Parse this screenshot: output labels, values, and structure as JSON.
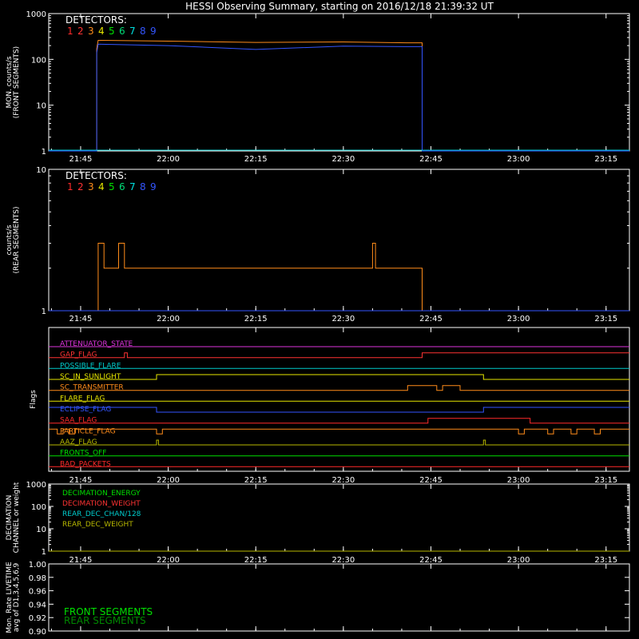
{
  "title": "HESSI Observing Summary, starting on 2016/12/18 21:39:32 UT",
  "time_ticks": [
    "21:45",
    "22:00",
    "22:15",
    "22:30",
    "22:45",
    "23:00",
    "23:15"
  ],
  "colors": {
    "axes": "#ffffff",
    "det": [
      "#ff2a2a",
      "#ff3333",
      "#ff8c1a",
      "#e6e600",
      "#00e000",
      "#00dd77",
      "#00e0e0",
      "#3355ff",
      "#3355ff"
    ]
  },
  "detectors_label": "DETECTORS:",
  "detector_numbers": [
    "1",
    "2",
    "3",
    "4",
    "5",
    "6",
    "7",
    "8",
    "9"
  ],
  "chart_data": [
    {
      "name": "front",
      "type": "line",
      "ylabel": [
        "MON. counts/s",
        "(FRONT SEGMENTS)"
      ],
      "yscale": "log",
      "ylim": [
        1,
        1000
      ],
      "yticks": [
        "1",
        "10",
        "100",
        "1000"
      ],
      "series": [
        {
          "color": "#ff8c1a",
          "points": [
            [
              "21:39:32",
              1
            ],
            [
              "21:47:45",
              1
            ],
            [
              "21:47:45",
              170
            ],
            [
              "21:48:00",
              260
            ],
            [
              "22:00:00",
              250
            ],
            [
              "22:15:00",
              235
            ],
            [
              "22:30:00",
              240
            ],
            [
              "22:41:00",
              230
            ],
            [
              "22:43:30",
              230
            ],
            [
              "22:43:30",
              1
            ],
            [
              "23:19:00",
              1
            ]
          ]
        },
        {
          "color": "#3355ff",
          "points": [
            [
              "21:39:32",
              1
            ],
            [
              "21:47:45",
              1
            ],
            [
              "21:47:45",
              140
            ],
            [
              "21:48:00",
              215
            ],
            [
              "22:00:00",
              200
            ],
            [
              "22:15:00",
              165
            ],
            [
              "22:30:00",
              195
            ],
            [
              "22:41:00",
              190
            ],
            [
              "22:43:30",
              190
            ],
            [
              "22:43:30",
              1
            ],
            [
              "23:19:00",
              1
            ]
          ]
        }
      ]
    },
    {
      "name": "rear",
      "type": "line",
      "ylabel": [
        "counts/s",
        "(REAR SEGMENTS)"
      ],
      "yscale": "log",
      "ylim": [
        1,
        10
      ],
      "yticks": [
        "1",
        "10"
      ],
      "series": [
        {
          "color": "#ff8c1a",
          "points": [
            [
              "21:39:32",
              1
            ],
            [
              "21:48:00",
              1
            ],
            [
              "21:48:00",
              3
            ],
            [
              "21:49:00",
              3
            ],
            [
              "21:49:00",
              2
            ],
            [
              "21:51:30",
              2
            ],
            [
              "21:51:30",
              3
            ],
            [
              "21:52:30",
              3
            ],
            [
              "21:52:30",
              2
            ],
            [
              "21:55:00",
              2
            ],
            [
              "22:00:00",
              2
            ],
            [
              "22:15:00",
              2
            ],
            [
              "22:30:00",
              2
            ],
            [
              "22:35:00",
              2
            ],
            [
              "22:35:00",
              3
            ],
            [
              "22:35:30",
              3
            ],
            [
              "22:35:30",
              2
            ],
            [
              "22:43:30",
              2
            ],
            [
              "22:43:30",
              1
            ],
            [
              "23:19:00",
              1
            ]
          ]
        },
        {
          "color": "#3355ff",
          "points": [
            [
              "21:39:32",
              1
            ],
            [
              "23:19:00",
              1
            ]
          ]
        }
      ]
    },
    {
      "name": "flags",
      "type": "line",
      "ylabel": [
        "Flags"
      ],
      "rows": [
        {
          "label": "ATTENUATOR_STATE",
          "color": "#dd33dd",
          "steps": [
            [
              "21:39:32",
              0
            ],
            [
              "23:19:00",
              0
            ]
          ]
        },
        {
          "label": "GAP_FLAG",
          "color": "#ff3333",
          "steps": [
            [
              "21:39:32",
              0
            ],
            [
              "21:52:30",
              0
            ],
            [
              "21:52:30",
              1
            ],
            [
              "21:53:00",
              1
            ],
            [
              "21:53:00",
              0
            ],
            [
              "22:43:30",
              0
            ],
            [
              "22:43:30",
              1
            ],
            [
              "23:19:00",
              1
            ]
          ]
        },
        {
          "label": "POSSIBLE_FLARE",
          "color": "#00cccc",
          "steps": [
            [
              "21:39:32",
              0
            ],
            [
              "23:19:00",
              0
            ]
          ]
        },
        {
          "label": "SC_IN_SUNLIGHT",
          "color": "#e6e600",
          "steps": [
            [
              "21:39:32",
              0
            ],
            [
              "21:58:00",
              0
            ],
            [
              "21:58:00",
              1
            ],
            [
              "22:54:00",
              1
            ],
            [
              "22:54:00",
              0
            ],
            [
              "23:19:00",
              0
            ]
          ]
        },
        {
          "label": "SC_TRANSMITTER",
          "color": "#ff8c1a",
          "steps": [
            [
              "21:39:32",
              0
            ],
            [
              "22:41:00",
              0
            ],
            [
              "22:41:00",
              1
            ],
            [
              "22:46:00",
              1
            ],
            [
              "22:46:00",
              0
            ],
            [
              "22:47:00",
              0
            ],
            [
              "22:47:00",
              1
            ],
            [
              "22:50:00",
              1
            ],
            [
              "22:50:00",
              0
            ],
            [
              "23:19:00",
              0
            ]
          ]
        },
        {
          "label": "FLARE_FLAG",
          "color": "#e6e600",
          "steps": [
            [
              "21:39:32",
              0
            ],
            [
              "23:19:00",
              0
            ]
          ]
        },
        {
          "label": "ECLIPSE_FLAG",
          "color": "#3355ff",
          "steps": [
            [
              "21:39:32",
              1
            ],
            [
              "21:58:00",
              1
            ],
            [
              "21:58:00",
              0
            ],
            [
              "22:54:00",
              0
            ],
            [
              "22:54:00",
              1
            ],
            [
              "23:19:00",
              1
            ]
          ]
        },
        {
          "label": "SAA_FLAG",
          "color": "#ff2a2a",
          "steps": [
            [
              "21:39:32",
              0
            ],
            [
              "22:44:30",
              0
            ],
            [
              "22:44:30",
              1
            ],
            [
              "23:02:00",
              1
            ],
            [
              "23:02:00",
              0
            ],
            [
              "23:19:00",
              0
            ]
          ]
        },
        {
          "label": "PARTICLE_FLAG",
          "color": "#ff8c1a",
          "steps": [
            [
              "21:39:32",
              1
            ],
            [
              "21:41:00",
              1
            ],
            [
              "21:41:00",
              0
            ],
            [
              "21:42:00",
              0
            ],
            [
              "21:42:00",
              1
            ],
            [
              "21:43:00",
              1
            ],
            [
              "21:43:00",
              0
            ],
            [
              "21:44:00",
              0
            ],
            [
              "21:44:00",
              1
            ],
            [
              "21:58:00",
              1
            ],
            [
              "21:58:00",
              0
            ],
            [
              "21:59:00",
              0
            ],
            [
              "21:59:00",
              1
            ],
            [
              "23:00:00",
              1
            ],
            [
              "23:00:00",
              0
            ],
            [
              "23:01:00",
              0
            ],
            [
              "23:01:00",
              1
            ],
            [
              "23:05:00",
              1
            ],
            [
              "23:05:00",
              0
            ],
            [
              "23:06:00",
              0
            ],
            [
              "23:06:00",
              1
            ],
            [
              "23:09:00",
              1
            ],
            [
              "23:09:00",
              0
            ],
            [
              "23:10:00",
              0
            ],
            [
              "23:10:00",
              1
            ],
            [
              "23:13:00",
              1
            ],
            [
              "23:13:00",
              0
            ],
            [
              "23:14:00",
              0
            ],
            [
              "23:14:00",
              1
            ],
            [
              "23:19:00",
              1
            ]
          ]
        },
        {
          "label": "AAZ_FLAG",
          "color": "#b8b800",
          "steps": [
            [
              "21:39:32",
              0
            ],
            [
              "21:58:00",
              0
            ],
            [
              "21:58:00",
              1
            ],
            [
              "21:58:20",
              1
            ],
            [
              "21:58:20",
              0
            ],
            [
              "22:54:00",
              0
            ],
            [
              "22:54:00",
              1
            ],
            [
              "22:54:20",
              1
            ],
            [
              "22:54:20",
              0
            ],
            [
              "23:19:00",
              0
            ]
          ]
        },
        {
          "label": "FRONTS_OFF",
          "color": "#00e000",
          "steps": [
            [
              "21:39:32",
              0
            ],
            [
              "23:19:00",
              0
            ]
          ]
        },
        {
          "label": "BAD_PACKETS",
          "color": "#ff2a2a",
          "steps": [
            [
              "21:39:32",
              0
            ],
            [
              "23:19:00",
              0
            ]
          ]
        }
      ]
    },
    {
      "name": "decimation",
      "type": "line",
      "ylabel": [
        "DECIMATION",
        "CHANNEL or weight"
      ],
      "yscale": "log",
      "ylim": [
        1,
        1000
      ],
      "yticks": [
        "1",
        "10",
        "100",
        "1000"
      ],
      "legend": [
        {
          "label": "DECIMATION_ENERGY",
          "color": "#00e000"
        },
        {
          "label": "DECIMATION_WEIGHT",
          "color": "#ff3333"
        },
        {
          "label": "REAR_DEC_CHAN/128",
          "color": "#00cccc"
        },
        {
          "label": "REAR_DEC_WEIGHT",
          "color": "#b8b800"
        }
      ],
      "series": [
        {
          "color": "#b8b800",
          "points": [
            [
              "21:39:32",
              1
            ],
            [
              "23:19:00",
              1
            ]
          ]
        }
      ]
    },
    {
      "name": "livetime",
      "type": "line",
      "ylabel": [
        "Mon. Rate LIVETIME",
        "avg of D1,3,4,5,6,9"
      ],
      "ylim": [
        0.9,
        1.0
      ],
      "yticks": [
        "0.90",
        "0.92",
        "0.94",
        "0.96",
        "0.98",
        "1.00"
      ],
      "legend": [
        {
          "label": "FRONT SEGMENTS",
          "color": "#00e000"
        },
        {
          "label": "REAR SEGMENTS",
          "color": "#008800"
        }
      ],
      "series": []
    }
  ]
}
